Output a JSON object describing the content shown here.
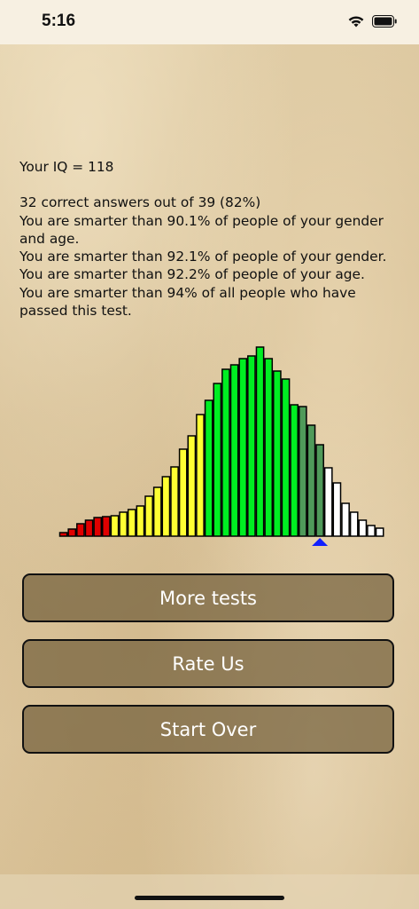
{
  "status_bar": {
    "time": "5:16",
    "icons": [
      "wifi-icon",
      "battery-icon"
    ]
  },
  "results": {
    "iq_line": "Your IQ = 118",
    "correct_line": "32 correct answers out of 39 (82%)",
    "gender_age_line": "You are smarter than 90.1% of people of your gender and age.",
    "gender_line": "You are smarter than 92.1% of people of your gender.",
    "age_line": "You are smarter than 92.2% of people of your age.",
    "all_line": "You are smarter than 94% of all people who have passed this test."
  },
  "distribution": {
    "marker_icon": "triangle-marker-icon",
    "marker_bar_index": 30,
    "colors": {
      "red": "#e00000",
      "yellow": "#ffff33",
      "green": "#00ee22",
      "dark_green": "#4f9a5a",
      "white": "#ffffff",
      "marker": "#1020ff"
    },
    "bars": [
      {
        "value": 4,
        "color": "red"
      },
      {
        "value": 8,
        "color": "red"
      },
      {
        "value": 14,
        "color": "red"
      },
      {
        "value": 18,
        "color": "red"
      },
      {
        "value": 21,
        "color": "red"
      },
      {
        "value": 22,
        "color": "red"
      },
      {
        "value": 23,
        "color": "yellow"
      },
      {
        "value": 27,
        "color": "yellow"
      },
      {
        "value": 30,
        "color": "yellow"
      },
      {
        "value": 34,
        "color": "yellow"
      },
      {
        "value": 45,
        "color": "yellow"
      },
      {
        "value": 55,
        "color": "yellow"
      },
      {
        "value": 67,
        "color": "yellow"
      },
      {
        "value": 78,
        "color": "yellow"
      },
      {
        "value": 98,
        "color": "yellow"
      },
      {
        "value": 113,
        "color": "yellow"
      },
      {
        "value": 137,
        "color": "yellow"
      },
      {
        "value": 153,
        "color": "green"
      },
      {
        "value": 172,
        "color": "green"
      },
      {
        "value": 188,
        "color": "green"
      },
      {
        "value": 193,
        "color": "green"
      },
      {
        "value": 200,
        "color": "green"
      },
      {
        "value": 203,
        "color": "green"
      },
      {
        "value": 213,
        "color": "green"
      },
      {
        "value": 200,
        "color": "green"
      },
      {
        "value": 186,
        "color": "green"
      },
      {
        "value": 177,
        "color": "green"
      },
      {
        "value": 148,
        "color": "green"
      },
      {
        "value": 146,
        "color": "dark_green"
      },
      {
        "value": 125,
        "color": "dark_green"
      },
      {
        "value": 103,
        "color": "dark_green"
      },
      {
        "value": 77,
        "color": "white"
      },
      {
        "value": 60,
        "color": "white"
      },
      {
        "value": 37,
        "color": "white"
      },
      {
        "value": 27,
        "color": "white"
      },
      {
        "value": 18,
        "color": "white"
      },
      {
        "value": 12,
        "color": "white"
      },
      {
        "value": 9,
        "color": "white"
      }
    ]
  },
  "buttons": {
    "more_tests": "More tests",
    "rate_us": "Rate Us",
    "start_over": "Start Over"
  }
}
